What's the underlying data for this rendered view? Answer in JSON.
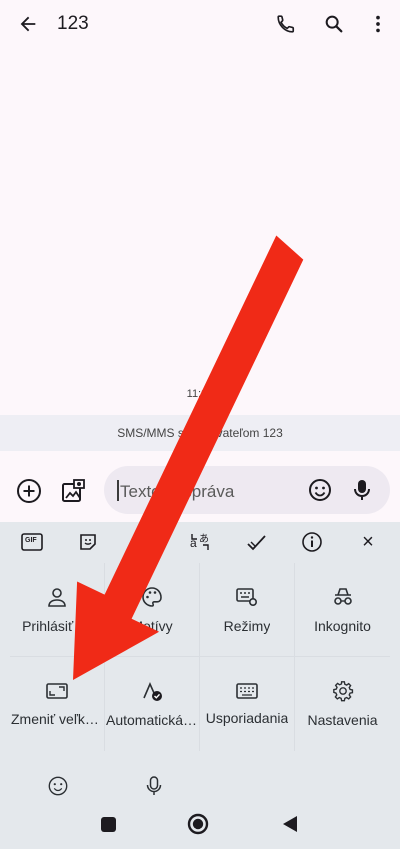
{
  "header": {
    "title": "123",
    "back_icon": "arrow-left-icon",
    "call_icon": "phone-icon",
    "search_icon": "search-icon",
    "menu_icon": "more-vert-icon"
  },
  "conversation": {
    "timestamp": "11:26",
    "sms_notice": "SMS/MMS s používateľom 123"
  },
  "composer": {
    "placeholder": "Textová správa"
  },
  "keyboard": {
    "toolbar": {
      "gif_label": "GIF",
      "close_label": "×"
    },
    "settings_items": [
      {
        "label": "Prihlásiť sa",
        "icon": "account-icon"
      },
      {
        "label": "Motívy",
        "icon": "palette-icon"
      },
      {
        "label": "Režimy",
        "icon": "modes-icon"
      },
      {
        "label": "Inkognito",
        "icon": "incognito-icon"
      },
      {
        "label": "Zmeniť veľkosť",
        "icon": "resize-icon"
      },
      {
        "label": "Automatická oprava",
        "icon": "autocorrect-icon"
      },
      {
        "label": "Usporiadania",
        "icon": "keyboard-icon"
      },
      {
        "label": "Nastavenia",
        "icon": "gear-icon"
      }
    ]
  },
  "colors": {
    "background": "#fdf7fb",
    "keyboard_background": "#e4e8ec",
    "arrow_annotation": "#f02a17"
  }
}
